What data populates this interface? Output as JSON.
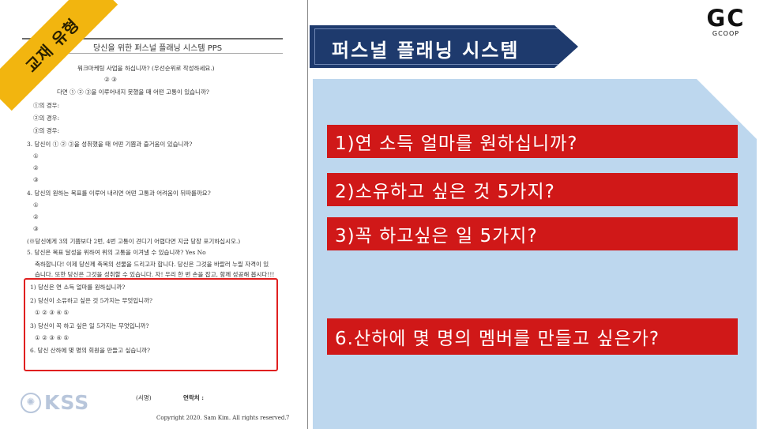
{
  "doc": {
    "sticker": "교재 유형",
    "title": "당신을 위한 퍼스널 플래닝 시스템 PPS",
    "lines": [
      "워크마케팅 사업을 하십니까? (우선순위로 작성하세요.)",
      "②                                        ③",
      "다면 ① ② ③을 이루어내지 못했을 때 어떤 고통이 있습니까?",
      "①의 경우:",
      "②의 경우:",
      "③의 경우:",
      "3. 당신이 ① ② ③을 성취했을 때 어떤 기쁨과 즐거움이 있습니까?",
      "①",
      "②",
      "③",
      "4. 당신의 원하는 목표를 이루어 내리면 어떤 고통과 어려움이 뒤따를까요?",
      "①",
      "②",
      "③",
      "(※당신에게 3의 기쁨보다 2번, 4번 고통이 견디기 어렵다면 지금 당장 포기하십시오.)",
      "5. 당신은 목표 달성을 위하여 위의 고통을 이겨낼 수 있습니까?   Yes    No",
      "축하합니다! 이제 당신께 축복의 선물을 드리고자 합니다. 당신은 그것을 바랄러 누릴 자격이 있",
      "습니다. 또한 당신은 그것을 성취할 수 있습니다. 자! 우리 한 번 손을 잡고, 함께 성공해 봅시다!!!"
    ],
    "box_lines": [
      "1) 당신은 연 소득 얼마를 원하십니까?",
      "2) 당신이 소유하고 싶은 것 5가지는 무엇입니까?",
      "①                 ②                 ③                 ④                 ⑤",
      "3) 당신이 꼭 하고 싶은 일 5가지는 무엇입니까?",
      "①                 ②                 ③                 ④                 ⑤",
      "6. 당신 산하에 몇 명의 회원을 만들고 싶습니까?"
    ],
    "signature_label": "(서명)",
    "contact_label": "연락처 :",
    "copyright": "Copyright 2020. Sam Kim. All rights reserved.",
    "page_number": "7",
    "logo_text": "KSS"
  },
  "slide": {
    "heading": "퍼스널 플래닝 시스템",
    "questions": [
      "1)연 소득 얼마를 원하십니까?",
      "2)소유하고 싶은 것 5가지?",
      "3)꼭 하고싶은 일 5가지?",
      "6.산하에 몇 명의 멤버를 만들고 싶은가?"
    ]
  },
  "brand": {
    "letters": "GC",
    "subtitle": "GCOOP"
  },
  "colors": {
    "banner": "#1e3a6d",
    "panel": "#bdd7ee",
    "question_bar": "#d01818",
    "sticker": "#f2b50f",
    "highlight_box": "#e02020"
  }
}
